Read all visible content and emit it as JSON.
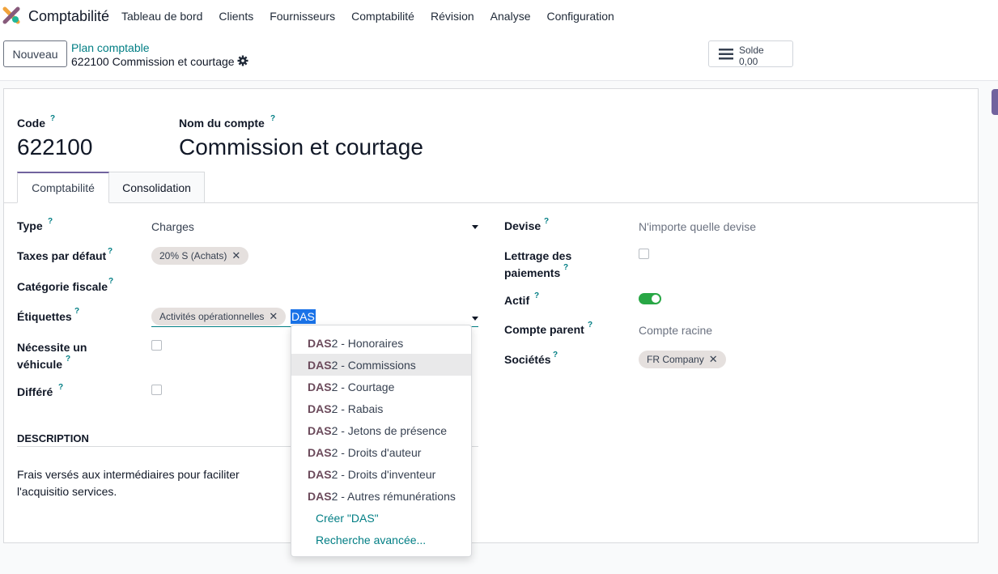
{
  "navbar": {
    "app_name": "Comptabilité",
    "menu": [
      "Tableau de bord",
      "Clients",
      "Fournisseurs",
      "Comptabilité",
      "Révision",
      "Analyse",
      "Configuration"
    ]
  },
  "control_panel": {
    "new_button": "Nouveau",
    "breadcrumb": "Plan comptable",
    "record_title": "622100 Commission et courtage",
    "balance_label": "Solde",
    "balance_value": "0,00"
  },
  "form": {
    "code_label": "Code",
    "code_value": "622100",
    "name_label": "Nom du compte",
    "name_value": "Commission et courtage",
    "help_mark": "?",
    "tabs": [
      "Comptabilité",
      "Consolidation"
    ],
    "left": {
      "type_label": "Type",
      "type_value": "Charges",
      "taxes_label": "Taxes par défaut",
      "taxes_tag": "20% S (Achats)",
      "fiscal_label": "Catégorie fiscale",
      "tags_label": "Étiquettes",
      "tags_tag": "Activités opérationnelles",
      "tags_input": "DAS",
      "vehicle_label_1": "Nécessite un",
      "vehicle_label_2": "véhicule",
      "deferred_label": "Différé"
    },
    "right": {
      "currency_label": "Devise",
      "currency_placeholder": "N'importe quelle devise",
      "reconcile_label_1": "Lettrage des",
      "reconcile_label_2": "paiements",
      "active_label": "Actif",
      "active_on": true,
      "parent_label": "Compte parent",
      "parent_placeholder": "Compte racine",
      "companies_label": "Sociétés",
      "company_tag": "FR Company"
    },
    "description_title": "DESCRIPTION",
    "description_text": "Frais versés aux intermédiaires pour faciliter l'acquisitio services."
  },
  "dropdown": {
    "match": "DAS",
    "items": [
      "2 - Honoraires",
      "2 - Commissions",
      "2 - Courtage",
      "2 - Rabais",
      "2 - Jetons de présence",
      "2 - Droits d'auteur",
      "2 - Droits d'inventeur",
      "2 - Autres rémunérations"
    ],
    "highlighted_index": 1,
    "create_label": "Créer \"DAS\"",
    "advanced_label": "Recherche avancée..."
  },
  "colors": {
    "brand": "#71639e",
    "link": "#017e84",
    "toggle_on": "#28a745",
    "match_text": "#6b4a5b"
  }
}
